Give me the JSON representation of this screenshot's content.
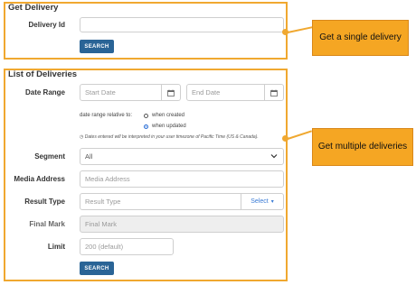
{
  "get_delivery": {
    "title": "Get Delivery",
    "delivery_id_label": "Delivery Id",
    "delivery_id_value": "",
    "search_label": "SEARCH"
  },
  "list_deliveries": {
    "title": "List of Deliveries",
    "date_range_label": "Date Range",
    "start_date_placeholder": "Start Date",
    "end_date_placeholder": "End Date",
    "relative_text": "date range relative to:",
    "option_created": "when created",
    "option_updated": "when updated",
    "timezone_note": "Dates entered will be interpreted in your user timezone of Pacific Time (US & Canada).",
    "segment_label": "Segment",
    "segment_value": "All",
    "media_label": "Media Address",
    "media_placeholder": "Media Address",
    "result_type_label": "Result Type",
    "result_type_placeholder": "Result Type",
    "select_label": "Select",
    "final_mark_label": "Final Mark",
    "final_mark_placeholder": "Final Mark",
    "limit_label": "Limit",
    "limit_placeholder": "200 (default)",
    "search_label": "SEARCH"
  },
  "callouts": {
    "single": "Get a single delivery",
    "multiple": "Get multiple deliveries"
  },
  "colors": {
    "accent": "#f0a830",
    "button": "#2a6496",
    "callout": "#f5a623"
  }
}
